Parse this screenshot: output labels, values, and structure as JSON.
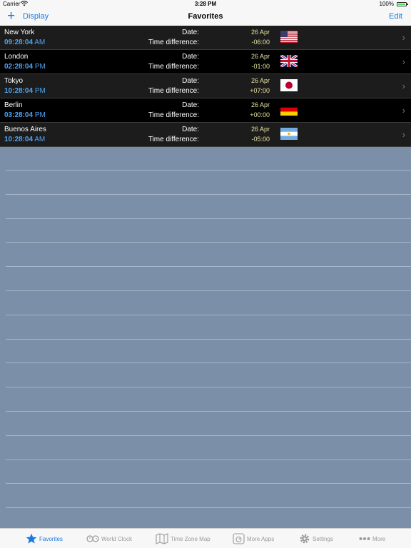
{
  "status_bar": {
    "carrier": "Carrier",
    "time": "3:28 PM",
    "battery": "100%"
  },
  "nav": {
    "left_label": "Display",
    "title": "Favorites",
    "right_label": "Edit"
  },
  "labels": {
    "date": "Date:",
    "time_difference": "Time difference:"
  },
  "rows": [
    {
      "city": "New York",
      "time": "09:28:04",
      "ampm": "AM",
      "date": "26 Apr",
      "diff": "-06:00",
      "flag": "us-flag-icon"
    },
    {
      "city": "London",
      "time": "02:28:04",
      "ampm": "PM",
      "date": "26 Apr",
      "diff": "-01:00",
      "flag": "uk-flag-icon"
    },
    {
      "city": "Tokyo",
      "time": "10:28:04",
      "ampm": "PM",
      "date": "26 Apr",
      "diff": "+07:00",
      "flag": "japan-flag-icon"
    },
    {
      "city": "Berlin",
      "time": "03:28:04",
      "ampm": "PM",
      "date": "26 Apr",
      "diff": "+00:00",
      "flag": "germany-flag-icon"
    },
    {
      "city": "Buenos Aires",
      "time": "10:28:04",
      "ampm": "AM",
      "date": "26 Apr",
      "diff": "-05:00",
      "flag": "argentina-flag-icon"
    }
  ],
  "tabs": [
    {
      "label": "Favorites",
      "icon": "star-icon",
      "active": true
    },
    {
      "label": "World Clock",
      "icon": "world-clock-icon",
      "active": false
    },
    {
      "label": "Time Zone Map",
      "icon": "map-icon",
      "active": false
    },
    {
      "label": "More Apps",
      "icon": "more-apps-icon",
      "active": false
    },
    {
      "label": "Settings",
      "icon": "gear-icon",
      "active": false
    },
    {
      "label": "More",
      "icon": "more-dots-icon",
      "active": false
    }
  ],
  "colors": {
    "accent": "#1a7ae0",
    "time_text": "#4fa3f0",
    "value_text": "#e8e3a2",
    "background": "#7b8fa9"
  }
}
